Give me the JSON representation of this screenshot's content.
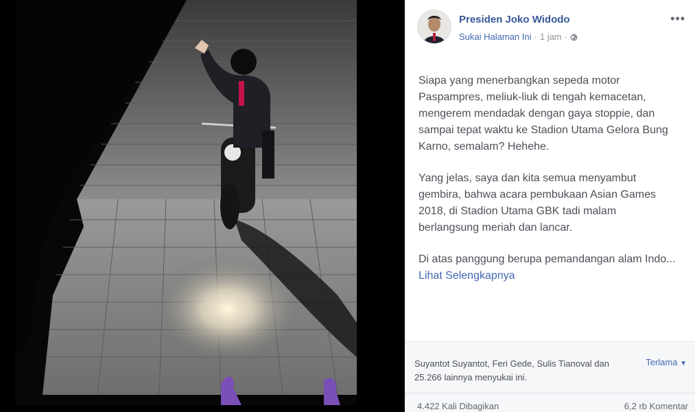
{
  "photo": {
    "alt_subject": "motorcycle-rider-waving"
  },
  "post": {
    "page_name": "Presiden Joko Widodo",
    "like_page": "Sukai Halaman Ini",
    "separator": "·",
    "time": "1 jam",
    "privacy_icon": "globe-icon",
    "more_icon": "ellipsis-icon",
    "paragraphs": [
      "Siapa yang menerbangkan sepeda motor Paspampres, meliuk-liuk di tengah kemacetan, mengerem mendadak dengan gaya stoppie, dan sampai tepat waktu ke Stadion Utama Gelora Bung Karno, semalam? Hehehe.",
      "Yang jelas, saya dan kita semua menyambut gembira, bahwa acara pembukaan Asian Games 2018, di Stadion Utama GBK tadi malam berlangsung meriah dan lancar."
    ],
    "truncated_text": "Di atas panggung berupa pemandangan alam Indo...",
    "see_more": "Lihat Selengkapnya"
  },
  "footer": {
    "likers": "Suyantot Suyantot, Feri Gede, Sulis Tianoval dan 25.266 lainnya menyukai ini.",
    "sort": "Terlama",
    "shares": "4.422 Kali Dibagikan",
    "comments": "6,2 rb Komentar"
  },
  "colors": {
    "link": "#365899",
    "accent": "#4267b2",
    "muted": "#90949c"
  }
}
